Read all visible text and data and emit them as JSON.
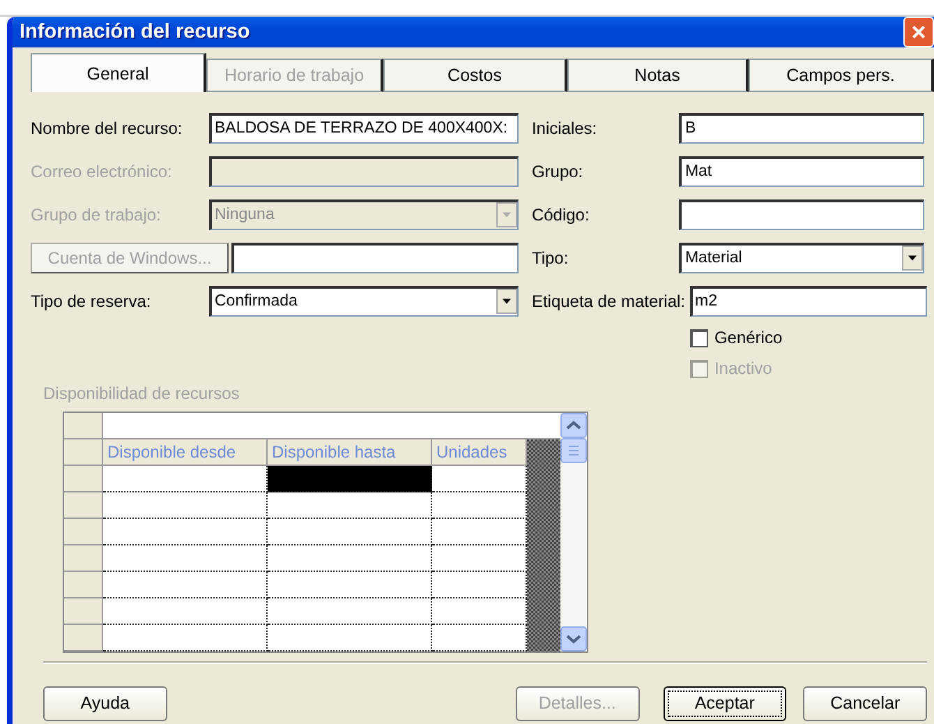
{
  "window": {
    "title": "Información del recurso",
    "close": "×"
  },
  "tabs": [
    {
      "label": "General",
      "selected": true,
      "disabled": false
    },
    {
      "label": "Horario de trabajo",
      "selected": false,
      "disabled": true
    },
    {
      "label": "Costos",
      "selected": false,
      "disabled": false
    },
    {
      "label": "Notas",
      "selected": false,
      "disabled": false
    },
    {
      "label": "Campos pers.",
      "selected": false,
      "disabled": false
    }
  ],
  "left_fields": [
    {
      "kind": "text",
      "label": "Nombre del recurso:",
      "value": "BALDOSA DE TERRAZO DE 400X400X:",
      "disabled": false
    },
    {
      "kind": "text",
      "label": "Correo electrónico:",
      "disabled": true
    },
    {
      "kind": "dropdown",
      "label": "Grupo de trabajo:",
      "value": "Ninguna",
      "disabled": true
    },
    {
      "kind": "button",
      "label": "Cuenta de Windows...",
      "disabled": true
    },
    {
      "kind": "dropdown",
      "label": "Tipo de reserva:",
      "value": "Confirmada",
      "disabled": false
    }
  ],
  "right_fields": [
    {
      "kind": "text",
      "label": "Iniciales:",
      "value": "B"
    },
    {
      "kind": "text",
      "label": "Grupo:",
      "value": "Mat"
    },
    {
      "kind": "text",
      "label": "Código:"
    },
    {
      "kind": "dropdown",
      "label": "Tipo:",
      "value": "Material"
    },
    {
      "kind": "wide",
      "label": "Etiqueta de material:",
      "value": "m2"
    }
  ],
  "checkboxes": [
    {
      "label": "Genérico",
      "checked": false,
      "disabled": false
    },
    {
      "label": "Inactivo",
      "checked": false,
      "disabled": true
    }
  ],
  "availability": {
    "title": "Disponibilidad de recursos",
    "columns": [
      "Disponible desde",
      "Disponible hasta",
      "Unidades"
    ],
    "rows": [
      {
        "cells": [
          {
            "selected": false
          },
          {
            "selected": true
          },
          {
            "selected": false
          }
        ]
      },
      {
        "cells": [
          {
            "selected": false
          },
          {
            "selected": false
          },
          {
            "selected": false
          }
        ]
      },
      {
        "cells": [
          {
            "selected": false
          },
          {
            "selected": false
          },
          {
            "selected": false
          }
        ]
      },
      {
        "cells": [
          {
            "selected": false
          },
          {
            "selected": false
          },
          {
            "selected": false
          }
        ]
      },
      {
        "cells": [
          {
            "selected": false
          },
          {
            "selected": false
          },
          {
            "selected": false
          }
        ]
      },
      {
        "cells": [
          {
            "selected": false
          },
          {
            "selected": false
          },
          {
            "selected": false
          }
        ]
      },
      {
        "cells": [
          {
            "selected": false
          },
          {
            "selected": false
          },
          {
            "selected": false
          }
        ]
      }
    ]
  },
  "buttons": [
    {
      "label": "Ayuda",
      "disabled": false,
      "default": false
    },
    {
      "label": "Detalles...",
      "disabled": true,
      "default": false
    },
    {
      "label": "Aceptar",
      "disabled": false,
      "default": true
    },
    {
      "label": "Cancelar",
      "disabled": false,
      "default": false
    }
  ]
}
